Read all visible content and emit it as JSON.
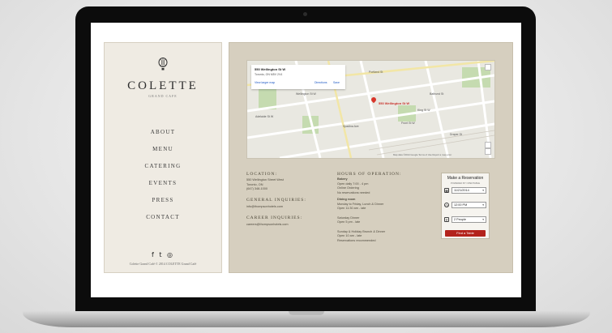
{
  "sidebar": {
    "logo": "COLETTE",
    "logo_sub": "GRAND CAFE",
    "nav": [
      "ABOUT",
      "MENU",
      "CATERING",
      "EVENTS",
      "PRESS",
      "CONTACT"
    ],
    "social": "f  t  ◎",
    "copyright": "Colette Grand Café © 2014 COLETTE Grand Café"
  },
  "map": {
    "card_address": "550 Wellington St W",
    "card_city": "Toronto, ON M5V 2V4",
    "card_larger": "View larger map",
    "card_directions": "Directions",
    "card_save": "Save",
    "pin_label": "550 Wellington St W",
    "street_labels": [
      "Portland St",
      "Wellington St W",
      "Bathurst St",
      "Front St W",
      "Spadina Ave",
      "Adelaide St W",
      "King St W",
      "Draper St"
    ],
    "footer": "Map data ©2014 Google  Terms of Use  Report a map error"
  },
  "location": {
    "title": "LOCATION:",
    "lines": [
      "550 Wellington Street West",
      "Toronto, ON",
      "(647) 348-1000"
    ]
  },
  "inquiries": {
    "title": "GENERAL INQUIRIES:",
    "lines": [
      "info@thompsonhotels.com"
    ]
  },
  "career": {
    "title": "CAREER INQUIRIES:",
    "lines": [
      "careers@thompsonhotels.com"
    ]
  },
  "hours": {
    "title": "HOURS OF OPERATION:",
    "sections": [
      {
        "head": "Bakery",
        "lines": [
          "Open daily 7:00 - 4 pm",
          "Online Ordering",
          "No reservations needed"
        ]
      },
      {
        "head": "Dining room",
        "lines": [
          "Monday to Friday, Lunch & Dinner",
          "Open 11:30 am - late"
        ]
      },
      {
        "head": "",
        "lines": [
          "Saturday Dinner",
          "Open 5 pm - late"
        ]
      },
      {
        "head": "",
        "lines": [
          "Sunday & Holiday Brunch & Dinner",
          "Open 10 am - late",
          "Reservations recommended"
        ]
      }
    ]
  },
  "reservation": {
    "title": "Make a Reservation",
    "subtitle": "POWERED BY OPENTABLE",
    "date": "11/21/2014",
    "time": "12:00 PM",
    "party": "2 People",
    "button": "Find a Table"
  }
}
